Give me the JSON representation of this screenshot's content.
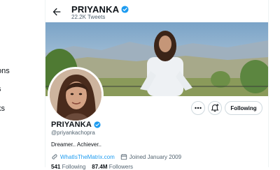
{
  "nav": {
    "items": [
      "ons",
      "s",
      "ks"
    ]
  },
  "header": {
    "title": "PRIYANKA",
    "subtitle": "22.2K Tweets"
  },
  "profile": {
    "name": "PRIYANKA",
    "handle": "@priyankachopra",
    "bio": "Dreamer.. Achiever..",
    "website": "WhatIsTheMatrix.com",
    "joined": "Joined January 2009",
    "stats": {
      "following_count": "541",
      "following_label": "Following",
      "followers_count": "87.4M",
      "followers_label": "Followers"
    }
  },
  "actions": {
    "following_label": "Following"
  },
  "colors": {
    "accent": "#1d9bf0",
    "text": "#0f1419",
    "muted": "#536471",
    "border": "#cfd9de"
  }
}
